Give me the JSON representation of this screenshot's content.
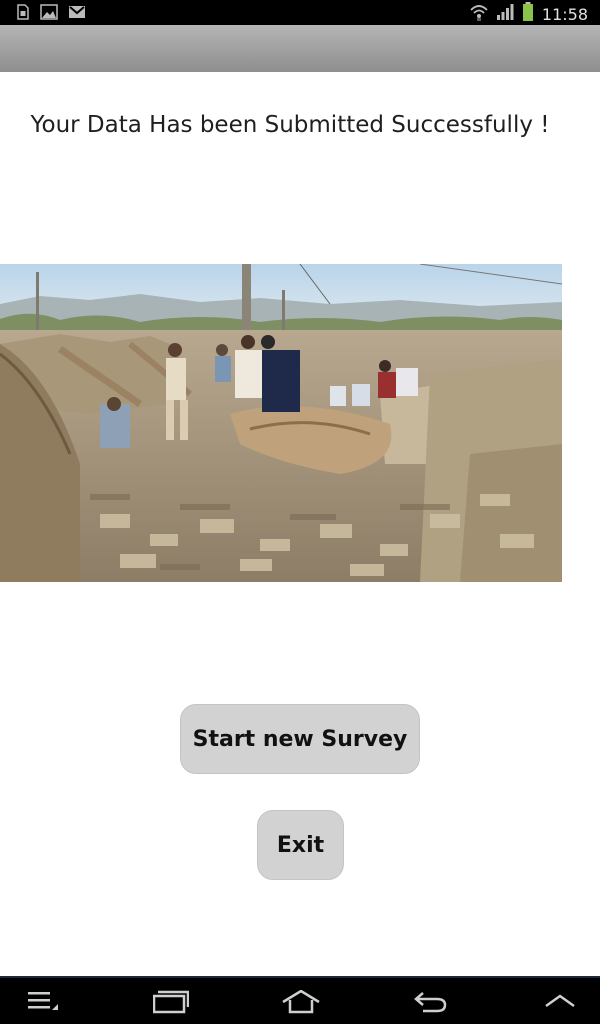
{
  "status_bar": {
    "time": "11:58",
    "left_icons": [
      "sim-card-icon",
      "gallery-icon",
      "gmail-icon"
    ],
    "right_icons": [
      "wifi-icon",
      "signal-icon",
      "battery-icon"
    ]
  },
  "main": {
    "message": "Your Data Has been Submitted Successfully !",
    "image": "earthquake-rubble-photo",
    "start_button_label": "Start new Survey",
    "exit_button_label": "Exit"
  },
  "nav_bar": {
    "icons": [
      "menu-icon",
      "recent-apps-icon",
      "home-icon",
      "back-icon",
      "up-chevron-icon"
    ]
  },
  "colors": {
    "status_bar": "#000000",
    "action_bar": "#a3a3a3",
    "button_bg": "#d2d2d2",
    "background": "#ffffff"
  }
}
